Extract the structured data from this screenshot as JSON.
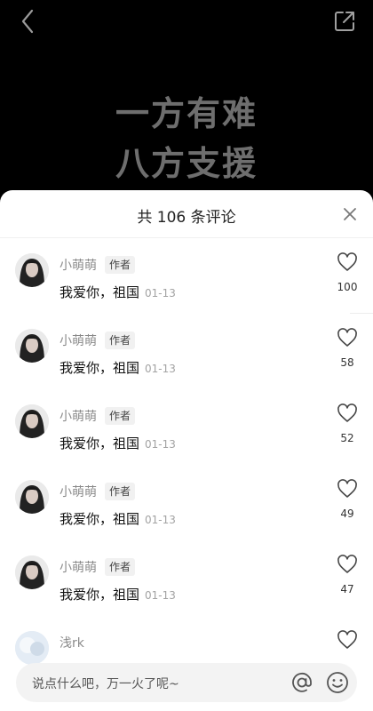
{
  "video": {
    "line1": "一方有难",
    "line2": "八方支援"
  },
  "comments_panel": {
    "title": "共 106 条评论"
  },
  "comments": [
    {
      "user": "小萌萌",
      "tag": "作者",
      "text": "我爱你，祖国",
      "date": "01-13",
      "likes": "100"
    },
    {
      "user": "小萌萌",
      "tag": "作者",
      "text": "我爱你，祖国",
      "date": "01-13",
      "likes": "58"
    },
    {
      "user": "小萌萌",
      "tag": "作者",
      "text": "我爱你，祖国",
      "date": "01-13",
      "likes": "52"
    },
    {
      "user": "小萌萌",
      "tag": "作者",
      "text": "我爱你，祖国",
      "date": "01-13",
      "likes": "49"
    },
    {
      "user": "小萌萌",
      "tag": "作者",
      "text": "我爱你，祖国",
      "date": "01-13",
      "likes": "47"
    },
    {
      "user": "浅rk"
    }
  ],
  "input": {
    "placeholder": "说点什么吧，万一火了呢~"
  },
  "icons": {
    "back": "chevron-left-icon",
    "share": "share-icon",
    "close": "close-icon",
    "like": "heart-outline-icon",
    "mention": "at-icon",
    "emoji": "smile-icon"
  }
}
